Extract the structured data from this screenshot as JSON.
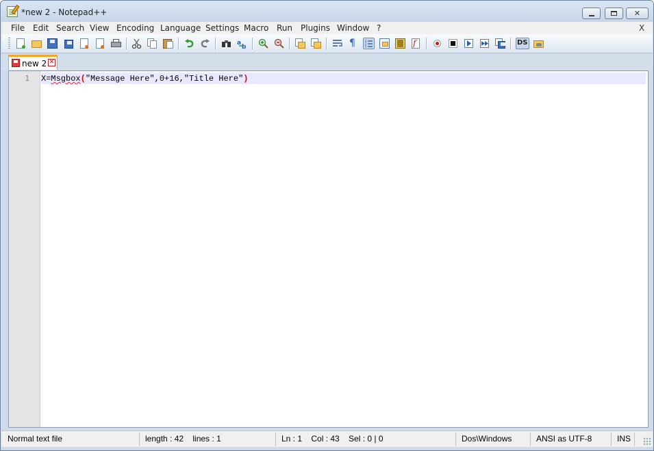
{
  "window": {
    "title": "*new  2 - Notepad++",
    "controls": {
      "minimize": "",
      "maximize": "",
      "close": "✕"
    }
  },
  "menu": {
    "items": [
      "File",
      "Edit",
      "Search",
      "View",
      "Encoding",
      "Language",
      "Settings",
      "Macro",
      "Run",
      "Plugins",
      "Window",
      "?"
    ],
    "close_label": "X"
  },
  "toolbar": {
    "buttons": [
      "new-file-icon",
      "open-file-icon",
      "save-icon",
      "save-all-icon",
      "close-icon",
      "close-all-icon",
      "print-icon",
      "cut-icon",
      "copy-icon",
      "paste-icon",
      "undo-icon",
      "redo-icon",
      "find-icon",
      "replace-icon",
      "zoom-in-icon",
      "zoom-out-icon",
      "sync-vertical-icon",
      "sync-horizontal-icon",
      "word-wrap-icon",
      "show-all-chars-icon",
      "indent-guide-icon",
      "user-lang-icon",
      "doc-map-icon",
      "function-list-icon",
      "record-macro-icon",
      "stop-record-icon",
      "play-macro-icon",
      "run-macro-multiple-icon",
      "save-macro-icon",
      "ds-plugin-icon",
      "plugin-toolbar-icon"
    ],
    "ds_label": "DS"
  },
  "tabs": [
    {
      "label": "new  2",
      "modified": true
    }
  ],
  "editor": {
    "line_number": "1",
    "code_prefix": "X=",
    "code_misspelled": "Msgbox",
    "code_open_paren": "(",
    "code_args": "\"Message Here\",0+16,\"Title Here\"",
    "code_close_paren": ")"
  },
  "status": {
    "file_type": "Normal text file",
    "length": "length : 42    lines : 1",
    "position": "Ln : 1    Col : 43    Sel : 0 | 0",
    "eol": "Dos\\Windows",
    "encoding": "ANSI as UTF-8",
    "mode": "INS"
  },
  "colors": {
    "accent_tab": "#f5a623",
    "current_line": "#e8e8ff",
    "brace": "#e00000",
    "spell_error": "#e03030"
  }
}
